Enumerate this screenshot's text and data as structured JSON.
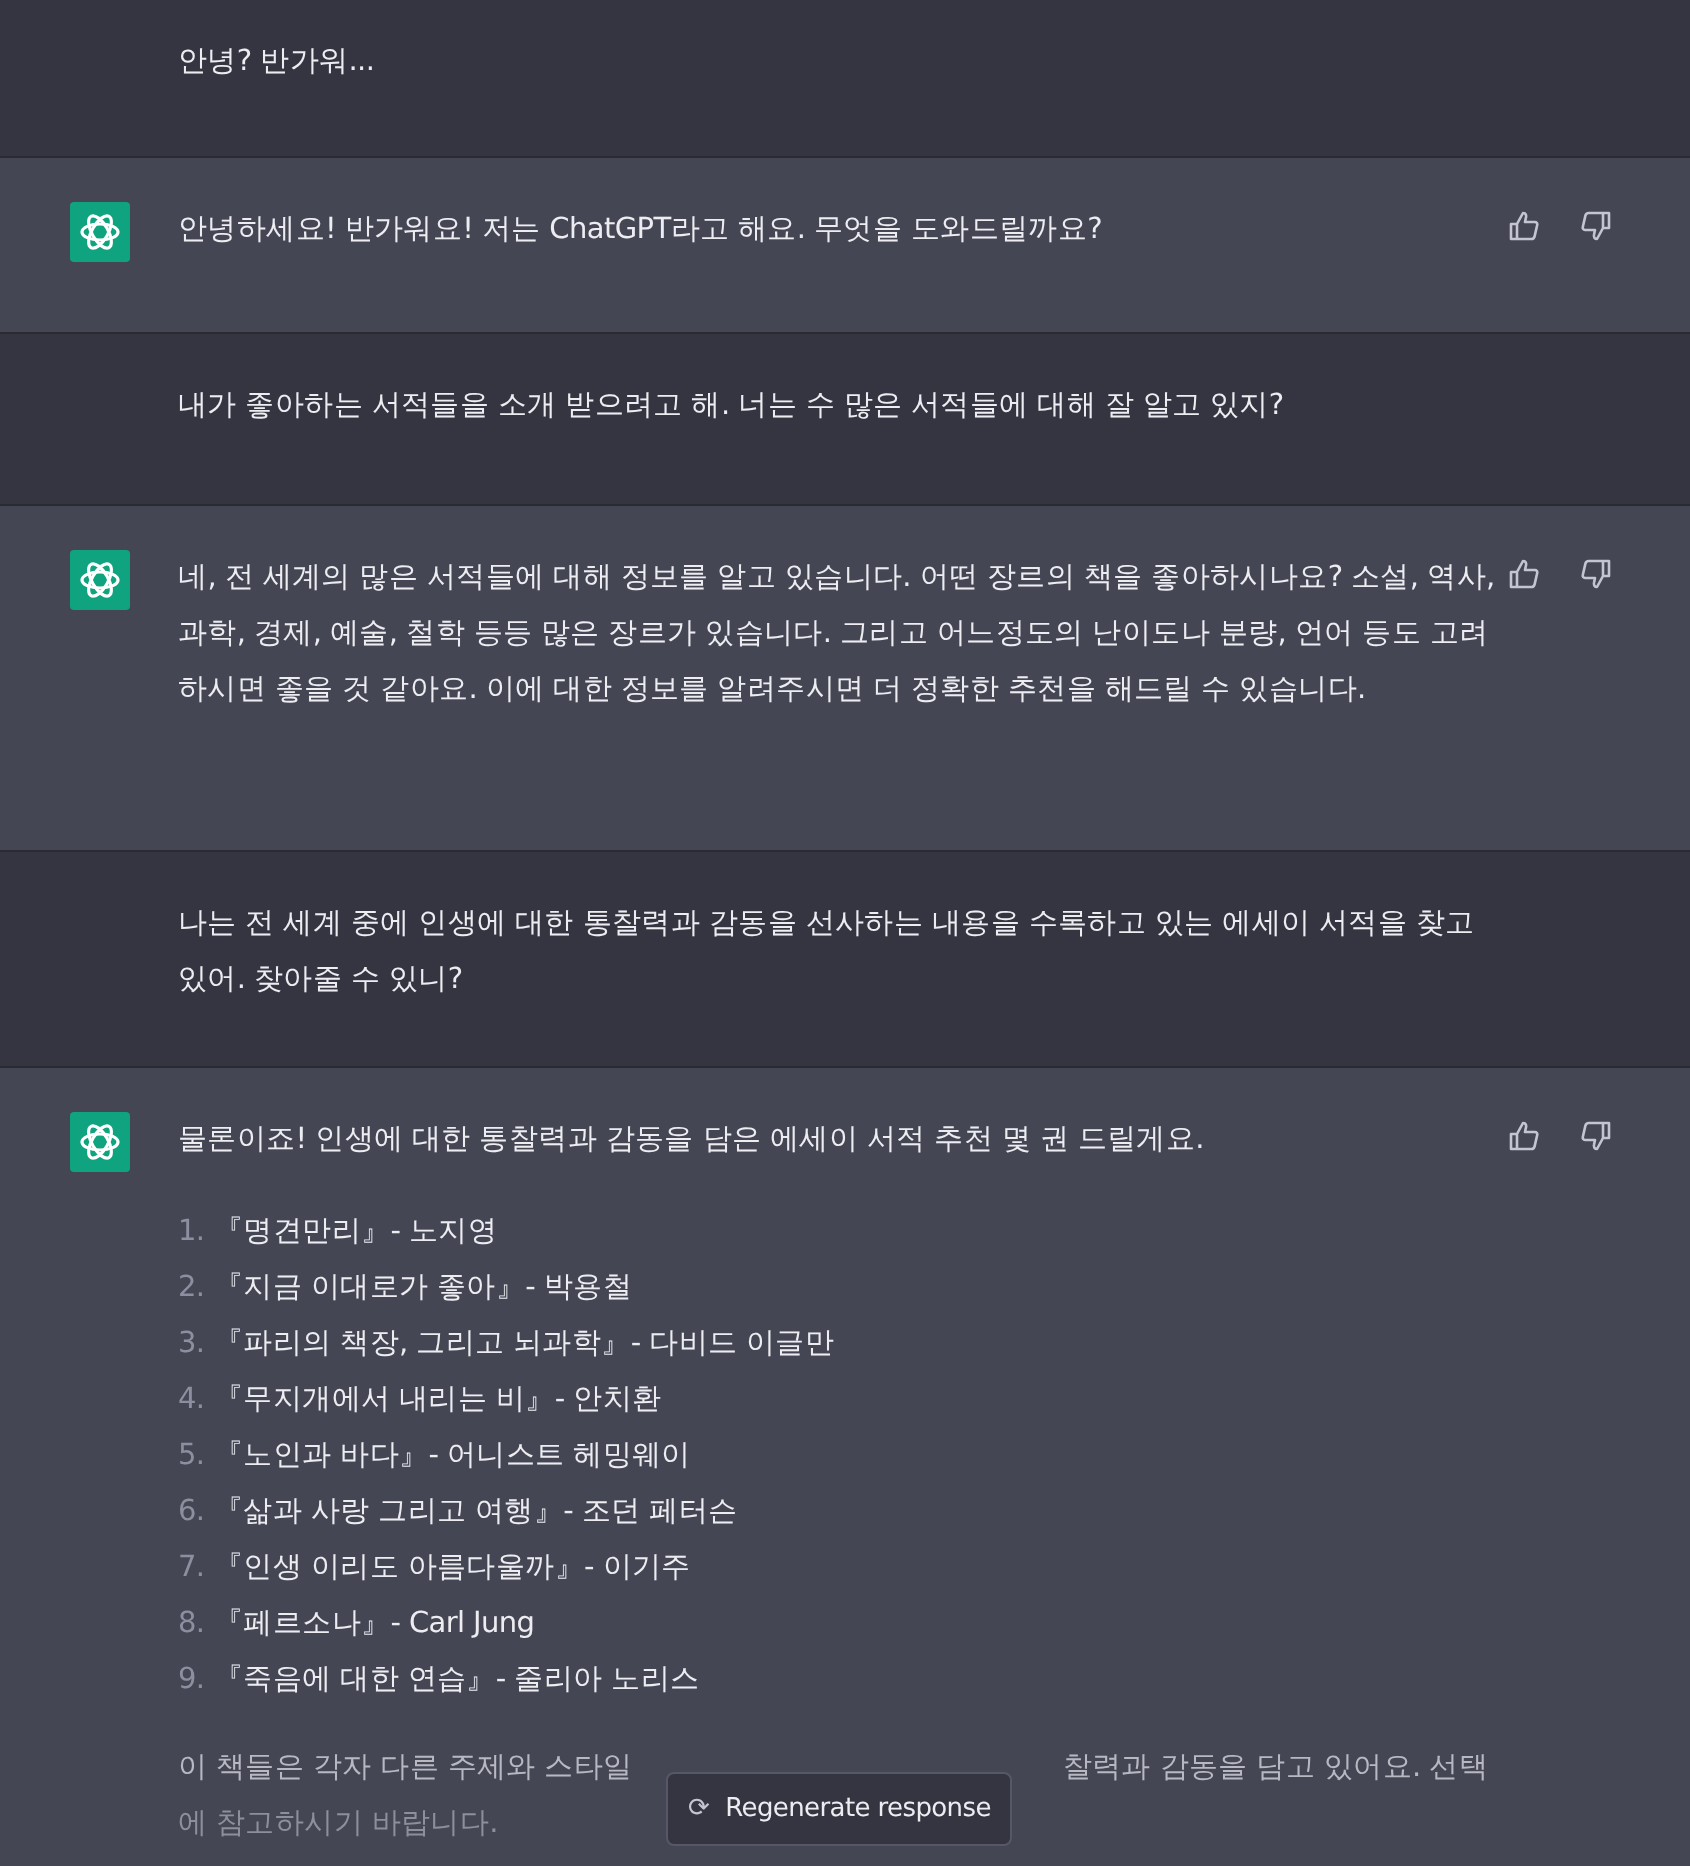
{
  "messages": [
    {
      "kind": "user",
      "text": "안녕? 반가워..."
    },
    {
      "kind": "assistant",
      "text": "안녕하세요! 반가워요! 저는 ChatGPT라고 해요. 무엇을 도와드릴까요?"
    },
    {
      "kind": "user",
      "text": "내가 좋아하는 서적들을 소개 받으려고 해. 너는 수 많은 서적들에 대해 잘 알고 있지?"
    },
    {
      "kind": "assistant",
      "text": "네, 전 세계의 많은 서적들에 대해 정보를 알고 있습니다. 어떤 장르의 책을 좋아하시나요? 소설, 역사, 과학, 경제, 예술, 철학 등등 많은 장르가 있습니다. 그리고 어느정도의 난이도나 분량, 언어 등도 고려하시면 좋을 것 같아요. 이에 대한 정보를 알려주시면 더 정확한 추천을 해드릴 수 있습니다."
    },
    {
      "kind": "user",
      "text": "나는 전 세계 중에 인생에 대한 통찰력과 감동을 선사하는 내용을 수록하고 있는 에세이 서적을 찾고 있어. 찾아줄 수 있니?"
    },
    {
      "kind": "assistant",
      "text": "물론이죠! 인생에 대한 통찰력과 감동을 담은 에세이 서적 추천 몇 권 드릴게요.",
      "list": [
        {
          "number": "1.",
          "text": "『명견만리』- 노지영"
        },
        {
          "number": "2.",
          "text": "『지금 이대로가 좋아』- 박용철"
        },
        {
          "number": "3.",
          "text": "『파리의 책장, 그리고 뇌과학』- 다비드 이글만"
        },
        {
          "number": "4.",
          "text": "『무지개에서 내리는 비』- 안치환"
        },
        {
          "number": "5.",
          "text": "『노인과 바다』- 어니스트 헤밍웨이"
        },
        {
          "number": "6.",
          "text": "『삶과 사랑 그리고 여행』- 조던 페터슨"
        },
        {
          "number": "7.",
          "text": "『인생 이리도 아름다울까』- 이기주"
        },
        {
          "number": "8.",
          "text": "『페르소나』- Carl Jung"
        },
        {
          "number": "9.",
          "text": "『죽음에 대한 연습』- 줄리아 노리스"
        }
      ],
      "closing_left": "이 책들은 각자 다른 주제와 스타일",
      "closing_right": "찰력과 감동을 담고 있어요. 선택",
      "closing_line2": "에 참고하시기 바랍니다."
    }
  ],
  "regenerate_button": {
    "icon": "⟳",
    "label": "Regenerate response"
  }
}
